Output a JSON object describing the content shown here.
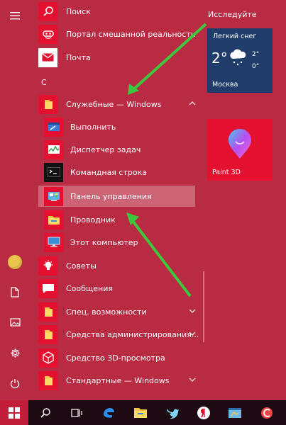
{
  "app_list": {
    "letter_c": "С",
    "items": [
      {
        "label": "Поиск",
        "icon": "search-icon"
      },
      {
        "label": "Портал смешанной реальности",
        "icon": "mixed-reality-headset-icon"
      },
      {
        "label": "Почта",
        "icon": "mail-icon"
      },
      {
        "label": "Служебные — Windows",
        "icon": "folder-icon",
        "expanded": true
      },
      {
        "label": "Выполнить",
        "icon": "run-icon"
      },
      {
        "label": "Диспетчер задач",
        "icon": "task-manager-icon"
      },
      {
        "label": "Командная строка",
        "icon": "command-prompt-icon"
      },
      {
        "label": "Панель управления",
        "icon": "control-panel-icon",
        "highlighted": true
      },
      {
        "label": "Проводник",
        "icon": "file-explorer-icon"
      },
      {
        "label": "Этот компьютер",
        "icon": "this-pc-icon"
      },
      {
        "label": "Советы",
        "icon": "tips-lightbulb-icon"
      },
      {
        "label": "Сообщения",
        "icon": "messages-icon"
      },
      {
        "label": "Спец. возможности",
        "icon": "folder-icon"
      },
      {
        "label": "Средства администрирования...",
        "icon": "folder-icon"
      },
      {
        "label": "Средство 3D-просмотра",
        "icon": "3d-viewer-icon"
      },
      {
        "label": "Стандартные — Windows",
        "icon": "folder-icon"
      }
    ]
  },
  "tiles": {
    "section_title": "Исследуйте",
    "weather": {
      "condition": "Легкий снег",
      "temp": "2°",
      "high": "2°",
      "low": "0°",
      "city": "Москва"
    },
    "paint3d": {
      "label": "Paint 3D"
    }
  },
  "colors": {
    "accent": "#b92b42",
    "tile": "#e4102f",
    "weather": "#1f3c6a",
    "taskbar": "#1d0a12"
  }
}
